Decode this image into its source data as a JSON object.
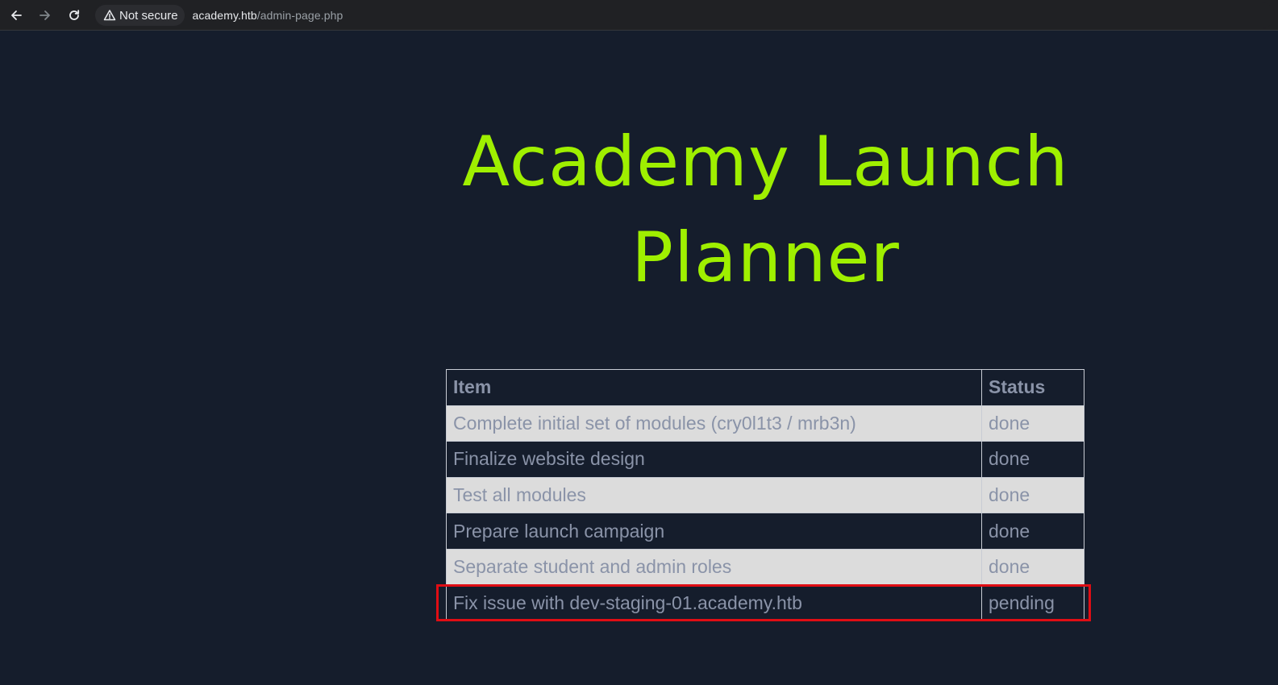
{
  "browser": {
    "security_label": "Not secure",
    "url_host": "academy.htb",
    "url_path": "/admin-page.php",
    "icons": {
      "back": "arrow-left-icon",
      "forward": "arrow-right-icon",
      "reload": "reload-icon",
      "security": "warning-triangle-icon"
    }
  },
  "page": {
    "title_line1": "Academy Launch",
    "title_line2": "Planner"
  },
  "table": {
    "headers": [
      "Item",
      "Status"
    ],
    "rows": [
      {
        "item": "Complete initial set of modules (cry0l1t3 / mrb3n)",
        "status": "done"
      },
      {
        "item": "Finalize website design",
        "status": "done"
      },
      {
        "item": "Test all modules",
        "status": "done"
      },
      {
        "item": "Prepare launch campaign",
        "status": "done"
      },
      {
        "item": "Separate student and admin roles",
        "status": "done"
      },
      {
        "item": "Fix issue with dev-staging-01.academy.htb",
        "status": "pending"
      }
    ]
  },
  "annotation": {
    "highlight_color": "#e00d14",
    "highlighted_row": 5
  },
  "colors": {
    "background": "#151d2c",
    "title": "#9fef00",
    "table_text": "#8a93a8",
    "row_light": "#dcdcdc"
  }
}
